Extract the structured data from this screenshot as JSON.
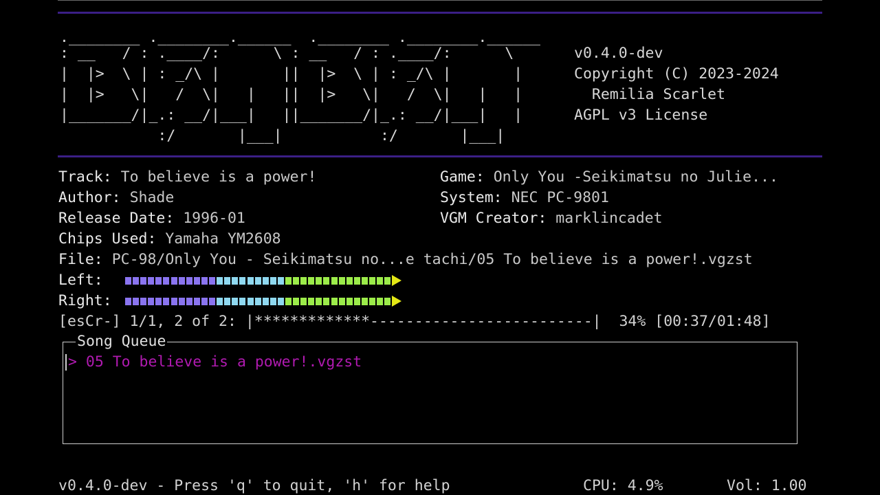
{
  "logo": {
    "lines": [
      ".________ .________.______  .________ .________.______",
      ": __   / : .____/:      \\ : __   / : .____/:      \\",
      "|  |>  \\ | : _/\\ |       ||  |>  \\ | : _/\\ |       |",
      "|  |>   \\|   /  \\|   |   ||  |>   \\|   /  \\|   |   |",
      "|_______/|_.: __/|___|   ||_______/|_.: __/|___|   |",
      "           :/       |___|           :/       |___|"
    ]
  },
  "about": {
    "version": "v0.4.0-dev",
    "copyright": "Copyright (C) 2023-2024",
    "author": "  Remilia Scarlet",
    "license": "AGPL v3 License"
  },
  "track": {
    "track_label": "Track:",
    "track_value": "To believe is a power!",
    "author_label": "Author:",
    "author_value": "Shade",
    "release_label": "Release Date:",
    "release_value": "1996-01",
    "chips_label": "Chips Used:",
    "chips_value": "Yamaha YM2608",
    "file_label": "File:",
    "file_value": "PC-98/Only You - Seikimatsu no...e tachi/05 To believe is a power!.vgzst",
    "game_label": "Game:",
    "game_value": "Only You -Seikimatsu no Julie...",
    "system_label": "System:",
    "system_value": "NEC PC-9801",
    "creator_label": "VGM Creator:",
    "creator_value": "marklincadet"
  },
  "meters": {
    "left_label": "Left:",
    "right_label": "Right:",
    "left_level": 0.59,
    "right_level": 0.59,
    "colors": {
      "low": "#8a74f0",
      "mid": "#8fd8f0",
      "high": "#9cec4a",
      "peak": "#e4e816"
    }
  },
  "progress": {
    "text": "[esCr-] 1/1, 2 of 2: |*************-------------------------|  34% [00:37/01:48]",
    "percent": 34
  },
  "queue": {
    "title": "Song Queue",
    "items": [
      {
        "label": "> 05 To believe is a power!.vgzst",
        "selected": true
      }
    ]
  },
  "status": {
    "help": "v0.4.0-dev - Press 'q' to quit, 'h' for help",
    "cpu": "CPU: 4.9%",
    "volume": "Vol: 1.00"
  },
  "theme": {
    "rule_color": "#3b1f86",
    "queue_selected_color": "#b01ab0"
  }
}
